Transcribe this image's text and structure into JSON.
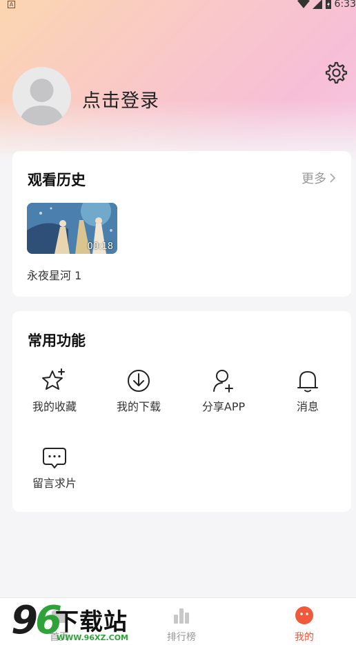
{
  "status_bar": {
    "badge": "A",
    "time": "6:33"
  },
  "header": {
    "login_text": "点击登录",
    "settings_icon": "gear-icon"
  },
  "history": {
    "title": "观看历史",
    "more_label": "更多",
    "items": [
      {
        "title": "永夜星河 1",
        "duration": "00:18"
      }
    ]
  },
  "functions": {
    "title": "常用功能",
    "items": [
      {
        "label": "我的收藏",
        "icon": "star-plus-icon"
      },
      {
        "label": "我的下载",
        "icon": "download-icon"
      },
      {
        "label": "分享APP",
        "icon": "user-add-icon"
      },
      {
        "label": "消息",
        "icon": "bell-icon"
      },
      {
        "label": "留言求片",
        "icon": "message-icon"
      }
    ]
  },
  "bottom_nav": {
    "items": [
      {
        "label": "首页",
        "icon": "home-icon"
      },
      {
        "label": "排行榜",
        "icon": "chart-icon"
      },
      {
        "label": "我的",
        "icon": "profile-face-icon"
      }
    ],
    "active_color": "#ee5a3b"
  },
  "watermark": {
    "number": "96",
    "text": "下载站",
    "url": "WWW.96XZ.COM"
  }
}
